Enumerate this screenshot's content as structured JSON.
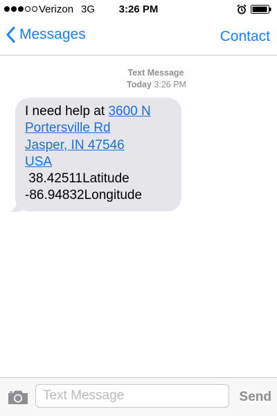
{
  "status_bar": {
    "carrier": "Verizon",
    "network": "3G",
    "time": "3:26 PM",
    "signal_strength": 3,
    "signal_max": 5,
    "alarm_icon": "alarm-clock-icon",
    "battery_icon": "battery-icon",
    "battery_level": 0.8
  },
  "nav": {
    "back_label": "Messages",
    "back_icon": "chevron-left-icon",
    "contact_label": "Contact",
    "accent_color": "#1a7ef5"
  },
  "thread": {
    "service_label": "Text Message",
    "day_label": "Today",
    "time_label": "3:26 PM"
  },
  "message": {
    "prefix": "I need help at ",
    "address_lines": [
      "3600 N",
      "Portersville Rd",
      "Jasper, IN 47546",
      "USA"
    ],
    "latitude_line": " 38.42511Latitude",
    "longitude_line": "-86.94832Longitude",
    "bubble_color": "#e5e5ea",
    "link_color": "#1a6fd9"
  },
  "input_bar": {
    "camera_icon": "camera-icon",
    "placeholder": "Text Message",
    "value": "",
    "send_label": "Send"
  }
}
